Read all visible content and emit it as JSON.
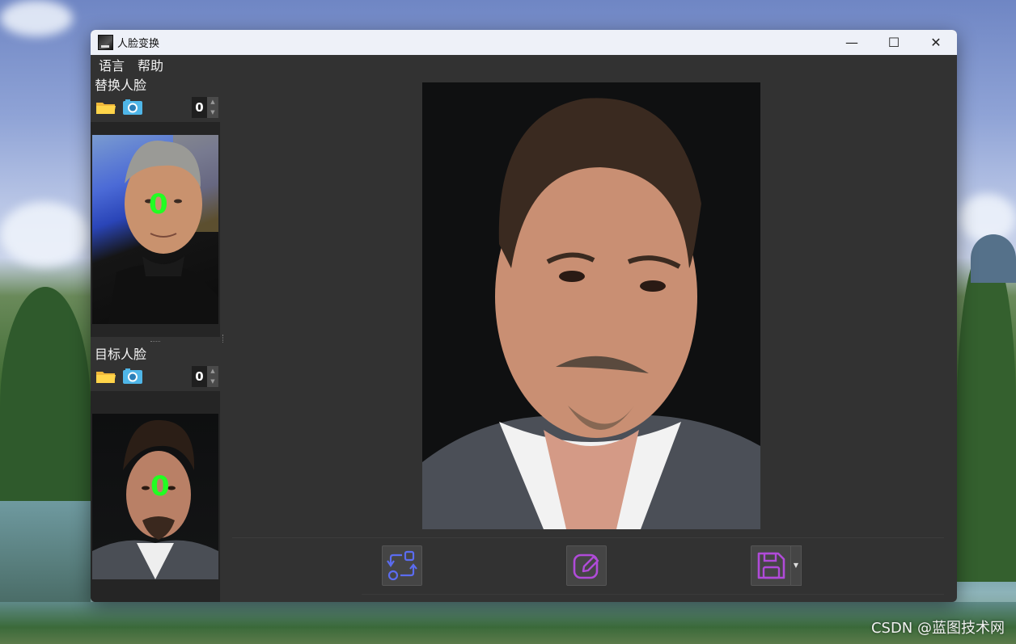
{
  "window": {
    "title": "人脸变换",
    "controls": {
      "minimize": "—",
      "maximize": "☐",
      "close": "✕"
    }
  },
  "menu": [
    "语言",
    "帮助"
  ],
  "swap_face": {
    "title": "替换人脸",
    "count": "0",
    "face_label": "0"
  },
  "target_face": {
    "title": "目标人脸",
    "count": "0",
    "face_label": "0"
  },
  "toolbar": {
    "icons": [
      "swap-icon",
      "edit-icon",
      "save-icon"
    ]
  },
  "colors": {
    "window_bg": "#323232",
    "titlebar_bg": "#eef1f8",
    "face_label": "#22ff22",
    "swap_icon": "#5b6cf0",
    "edit_icon": "#b04bd8",
    "save_icon": "#b04bd8"
  },
  "watermark": "CSDN @蓝图技术网"
}
